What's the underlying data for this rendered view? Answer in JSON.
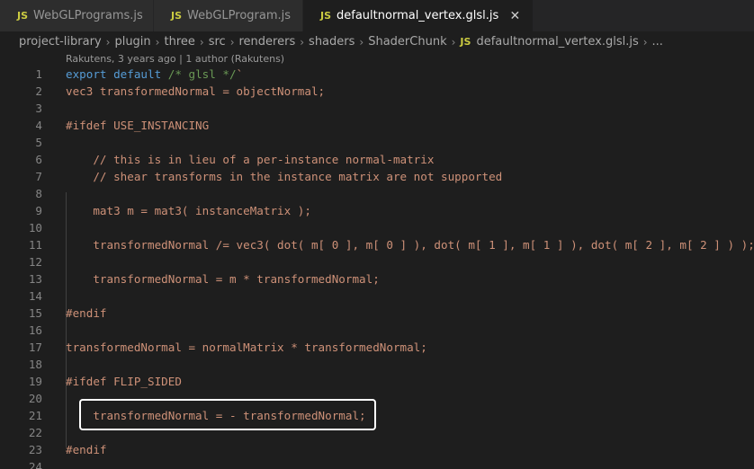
{
  "tabs": [
    {
      "icon": "JS",
      "label": "WebGLPrograms.js",
      "active": false
    },
    {
      "icon": "JS",
      "label": "WebGLProgram.js",
      "active": false
    },
    {
      "icon": "JS",
      "label": "defaultnormal_vertex.glsl.js",
      "active": true,
      "close": "✕"
    }
  ],
  "breadcrumb": {
    "items": [
      "project-library",
      "plugin",
      "three",
      "src",
      "renderers",
      "shaders",
      "ShaderChunk"
    ],
    "file_icon": "JS",
    "file": "defaultnormal_vertex.glsl.js",
    "more": "..."
  },
  "blame": "Rakutens, 3 years ago | 1 author (Rakutens)",
  "lines": [
    {
      "n": "1",
      "pre": "export default ",
      "comment": "/* glsl */",
      "post": "`"
    },
    {
      "n": "2",
      "text": "vec3 transformedNormal = objectNormal;"
    },
    {
      "n": "3",
      "text": ""
    },
    {
      "n": "4",
      "text": "#ifdef USE_INSTANCING"
    },
    {
      "n": "5",
      "text": ""
    },
    {
      "n": "6",
      "text": "    // this is in lieu of a per-instance normal-matrix"
    },
    {
      "n": "7",
      "text": "    // shear transforms in the instance matrix are not supported"
    },
    {
      "n": "8",
      "text": ""
    },
    {
      "n": "9",
      "text": "    mat3 m = mat3( instanceMatrix );"
    },
    {
      "n": "10",
      "text": ""
    },
    {
      "n": "11",
      "text": "    transformedNormal /= vec3( dot( m[ 0 ], m[ 0 ] ), dot( m[ 1 ], m[ 1 ] ), dot( m[ 2 ], m[ 2 ] ) );"
    },
    {
      "n": "12",
      "text": ""
    },
    {
      "n": "13",
      "text": "    transformedNormal = m * transformedNormal;"
    },
    {
      "n": "14",
      "text": ""
    },
    {
      "n": "15",
      "text": "#endif"
    },
    {
      "n": "16",
      "text": ""
    },
    {
      "n": "17",
      "text": "transformedNormal = normalMatrix * transformedNormal;"
    },
    {
      "n": "18",
      "text": ""
    },
    {
      "n": "19",
      "text": "#ifdef FLIP_SIDED"
    },
    {
      "n": "20",
      "text": ""
    },
    {
      "n": "21",
      "text": "    transformedNormal = - transformedNormal;"
    },
    {
      "n": "22",
      "text": ""
    },
    {
      "n": "23",
      "text": "#endif"
    },
    {
      "n": "24",
      "text": ""
    }
  ],
  "colors": {
    "keyword": "#569cd6",
    "comment": "#6a9955",
    "string": "#ce9178",
    "highlight_border": "#ffffff"
  }
}
